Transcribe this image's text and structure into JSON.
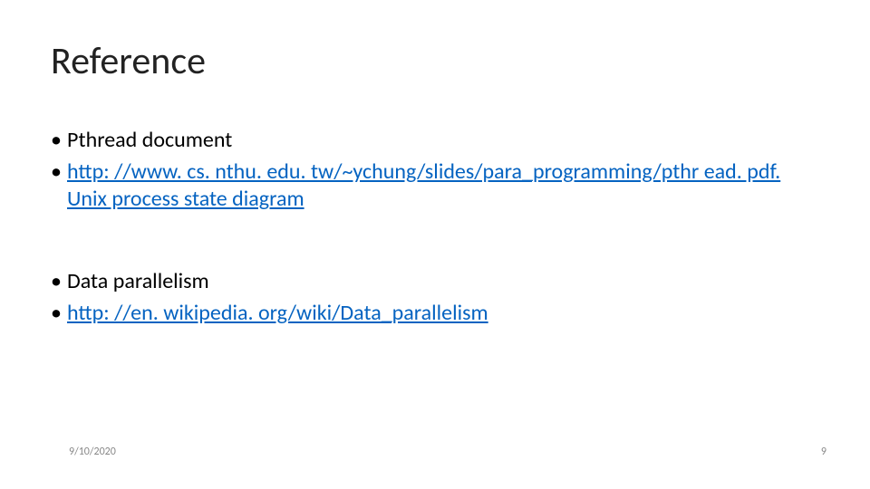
{
  "slide": {
    "title": "Reference",
    "bullets_group1": [
      {
        "text": "Pthread document",
        "is_link": false
      },
      {
        "text": "http: //www. cs. nthu. edu. tw/~ychung/slides/para_programming/pthr ead. pdf. Unix process state diagram",
        "is_link": true
      }
    ],
    "bullets_group2": [
      {
        "text": "Data parallelism",
        "is_link": false
      },
      {
        "text": "http: //en. wikipedia. org/wiki/Data_parallelism",
        "is_link": true
      }
    ],
    "footer": {
      "date": "9/10/2020",
      "page_number": "9"
    }
  }
}
